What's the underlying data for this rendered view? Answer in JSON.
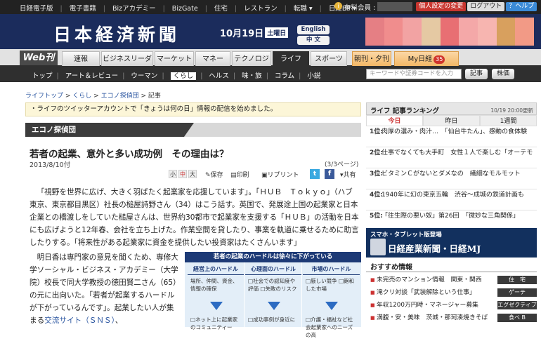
{
  "topbar": {
    "links": [
      "日経電子版",
      "電子書籍",
      "Bizアカデミー",
      "BizGate",
      "住宅",
      "レストラン",
      "転職 ▾",
      "日経BP ▾"
    ],
    "member_label": "有料会員 :",
    "member_icon": "i",
    "btn_change": "個人設定の変更",
    "btn_logout": "ログアウト",
    "btn_help": "？ヘルプ"
  },
  "masthead": {
    "logo": "日本経済新聞",
    "date": "10月19日",
    "weekday": "土曜日",
    "english": "English",
    "chinese": "中 文",
    "ad_colors": [
      "#e57f84",
      "#f08d8d",
      "#f2a3a3",
      "#e5c9a3",
      "#e86f73",
      "#f4a8a8",
      "#f7b5b0",
      "#d8a05e",
      "#f29a86"
    ]
  },
  "nav": {
    "web": "Web刊",
    "tabs": [
      "速報",
      "ビジネスリーダー",
      "マーケット",
      "マネー",
      "テクノロジー",
      "ライフ",
      "スポーツ"
    ],
    "morning": "朝刊・夕刊",
    "my": "My日経",
    "my_count": "35"
  },
  "subnav": {
    "items": [
      "トップ",
      "アート＆レビュー",
      "ウーマン",
      "くらし",
      "ヘルス",
      "味・旅",
      "コラム",
      "小説"
    ],
    "search_placeholder": "キーワードや証券コードを入力",
    "btn_article": "記事",
    "btn_stock": "株価"
  },
  "breadcrumb": {
    "items": [
      "ライフトップ",
      "くらし",
      "エコノ探偵団",
      "記事"
    ],
    "sep": " > "
  },
  "notice": "・ライフのツイッターアカウントで「きょうは何の日」情報の配信を始めました。",
  "category": "エコノ探偵団",
  "article": {
    "title": "若者の起業、意外と多い成功例　その理由は？",
    "date": "2013/8/10付",
    "pages": "(3/3ページ)",
    "font_small": "小",
    "font_mid": "中",
    "font_large": "大",
    "save": "保存",
    "print": "印刷",
    "reprint": "リプリント",
    "share": "共有",
    "twitter": "t",
    "facebook": "f",
    "lead": "「視野を世界に広げ、大きく羽ばたく起業家を応援しています」。「ＨＵＢ　Ｔｏｋｙｏ」（ハブ東京、東京都目黒区）社長の槌屋詩野さん（34）はこう話す。英国で、発展途上国の起業家と日本企業との橋渡しをしていた槌屋さんは、世界約30都市で起業家を支援する「ＨＵＢ」の活動を日本にも広げようと12年春、会社を立ち上げた。作業空間を貸したり、事業を軌道に乗せるために助言したりする。「将来性がある起業家に資金を提供したい投資家はたくさんいます」",
    "body_text": "明日香は専門家の意見を聞くため、専修大学ソーシャル・ビジネス・アカデミー（大学院）校長で同大学教授の徳田賢二さん（65）の元に出向いた。「若者が起業するハードルが下がっているんです」。起業したい人が集まる",
    "body_link": "交流サイト（ＳＮＳ）",
    "body_end": "、"
  },
  "figure": {
    "title": "若者の起業のハードルは徐々に下がっている",
    "cols": [
      {
        "head": "経営上のハードル",
        "text": "場所、仲間、資金、情報の確保",
        "after": "□ネット上に起業家のコミュニティー"
      },
      {
        "head": "心理面のハードル",
        "text": "□社会での認知度や評価 □失敗のリスク",
        "after": "□成功事例が身近に"
      },
      {
        "head": "市場のハードル",
        "text": "□厳しい競争 □飽和した市場",
        "after": "□介護・福祉など社会起業家へのニーズの高"
      }
    ]
  },
  "ranking": {
    "title": "ライフ 記事ランキング",
    "updated": "10/19 20:00更新",
    "tabs": [
      "今日",
      "昨日",
      "1週間"
    ],
    "items": [
      {
        "rank": "1位:",
        "text": "肉厚の濃み・肉汁…　「仙台牛たん」、感動の食体験"
      },
      {
        "rank": "2位:",
        "text": "仕事でなくても大手町　女性１人で楽しむ「オーテモ"
      },
      {
        "rank": "3位:",
        "text": "ビタミンＣがないとダメなの　繊細なモルモット"
      },
      {
        "rank": "4位:",
        "text": "1940年に幻の東京五輪　渋谷～成城の鉄道計画も"
      },
      {
        "rank": "5位:",
        "text": "「往生際の悪い奴」第26回　「微妙な三角関係」"
      }
    ]
  },
  "promo": {
    "line1": "スマホ・タブレット版登場",
    "line2": "日経産業新聞・日経MJ"
  },
  "recommend": {
    "title": "おすすめ情報",
    "items": [
      {
        "text": "未完売のマンション情報　関東・関西",
        "tag": "住　宅"
      },
      {
        "text": "滝クリ対談「武装解除という仕事」",
        "tag": "ゲーテ"
      },
      {
        "text": "年収1200万円時・マネージャー募集",
        "tag": "エグゼクティブ"
      },
      {
        "text": "満腹・安・美味　茨城・那珂湊焼きそば",
        "tag": "食べ B"
      }
    ]
  }
}
